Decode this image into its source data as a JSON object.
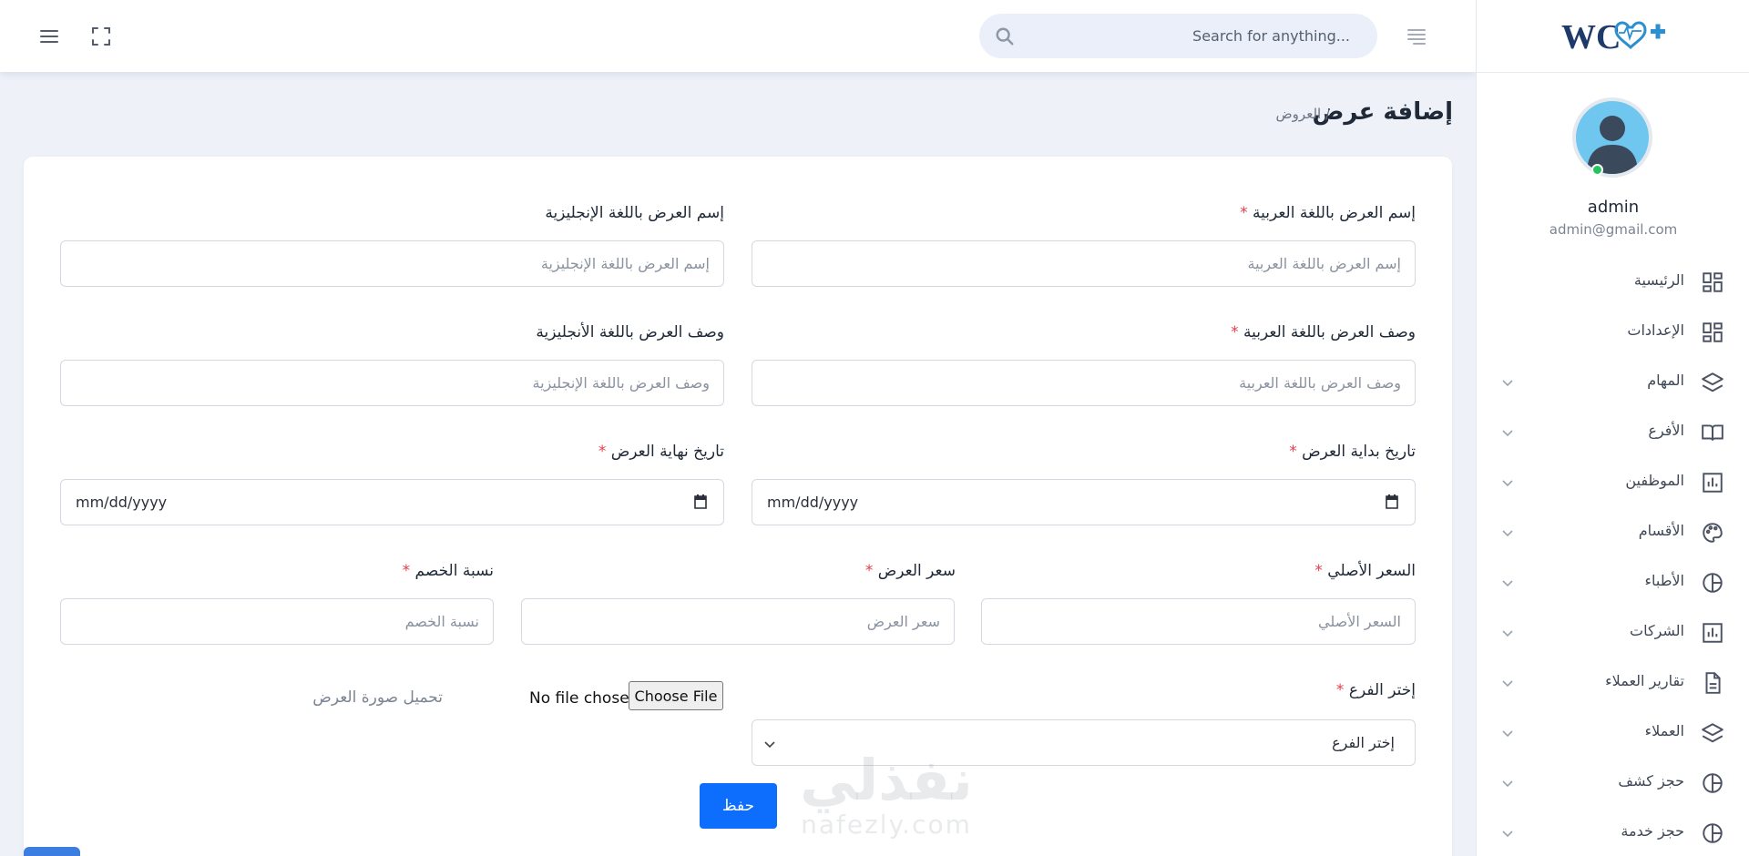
{
  "topbar": {
    "search_placeholder": "Search for anything..."
  },
  "sidebar": {
    "user": {
      "name": "admin",
      "email": "admin@gmail.com"
    },
    "items": [
      {
        "label": "الرئيسية",
        "icon": "dashboard-icon",
        "has_submenu": false
      },
      {
        "label": "الإعدادات",
        "icon": "dashboard-icon",
        "has_submenu": false
      },
      {
        "label": "المهام",
        "icon": "layers-icon",
        "has_submenu": true
      },
      {
        "label": "الأفرع",
        "icon": "book-icon",
        "has_submenu": true
      },
      {
        "label": "الموظفين",
        "icon": "bar-chart-icon",
        "has_submenu": true
      },
      {
        "label": "الأقسام",
        "icon": "palette-icon",
        "has_submenu": true
      },
      {
        "label": "الأطباء",
        "icon": "pie-chart-icon",
        "has_submenu": true
      },
      {
        "label": "الشركات",
        "icon": "bar-chart-icon",
        "has_submenu": true
      },
      {
        "label": "تقارير العملاء",
        "icon": "document-icon",
        "has_submenu": true
      },
      {
        "label": "العملاء",
        "icon": "layers-icon",
        "has_submenu": true
      },
      {
        "label": "حجز كشف",
        "icon": "pie-chart-icon",
        "has_submenu": true
      },
      {
        "label": "حجز خدمة",
        "icon": "pie-chart-icon",
        "has_submenu": true
      }
    ]
  },
  "page": {
    "title": "إضافة عرض",
    "breadcrumb": "/ العروض"
  },
  "form": {
    "name_ar": {
      "label": "إسم العرض باللغة العربية",
      "placeholder": "إسم العرض باللغة العربية",
      "required": "*"
    },
    "name_en": {
      "label": "إسم العرض باللغة الإنجليزية",
      "placeholder": "إسم العرض باللغة الإنجليزية"
    },
    "desc_ar": {
      "label": "وصف العرض باللغة العربية",
      "placeholder": "وصف العرض باللغة العربية",
      "required": "*"
    },
    "desc_en": {
      "label": "وصف العرض باللغة الأنجليزية",
      "placeholder": "وصف العرض  باللغة الإنجليزية"
    },
    "start_date": {
      "label": "تاريخ بداية العرض",
      "value": "mm/dd/yyyy",
      "required": "*"
    },
    "end_date": {
      "label": "تاريخ نهاية العرض",
      "value": "mm/dd/yyyy",
      "required": "*"
    },
    "original_price": {
      "label": "السعر الأصلي",
      "placeholder": "السعر الأصلي",
      "required": "*"
    },
    "offer_price": {
      "label": "سعر العرض",
      "placeholder": "سعر العرض",
      "required": "*"
    },
    "discount": {
      "label": "نسبة الخصم",
      "placeholder": "نسبة الخصم",
      "required": "*"
    },
    "branch": {
      "label": "إختر الفرع",
      "selected": "إختر الفرع",
      "required": "*"
    },
    "file": {
      "no_file": "No file chosen",
      "button": "Choose File",
      "label": "تحميل صورة العرض"
    },
    "save": "حفظ"
  },
  "watermark": {
    "arabic": "نفذلي",
    "latin": "nafezly.com"
  },
  "colors": {
    "primary": "#0d6efd",
    "required": "#e53e4c",
    "background": "#eef2f8",
    "online": "#22c55e"
  }
}
